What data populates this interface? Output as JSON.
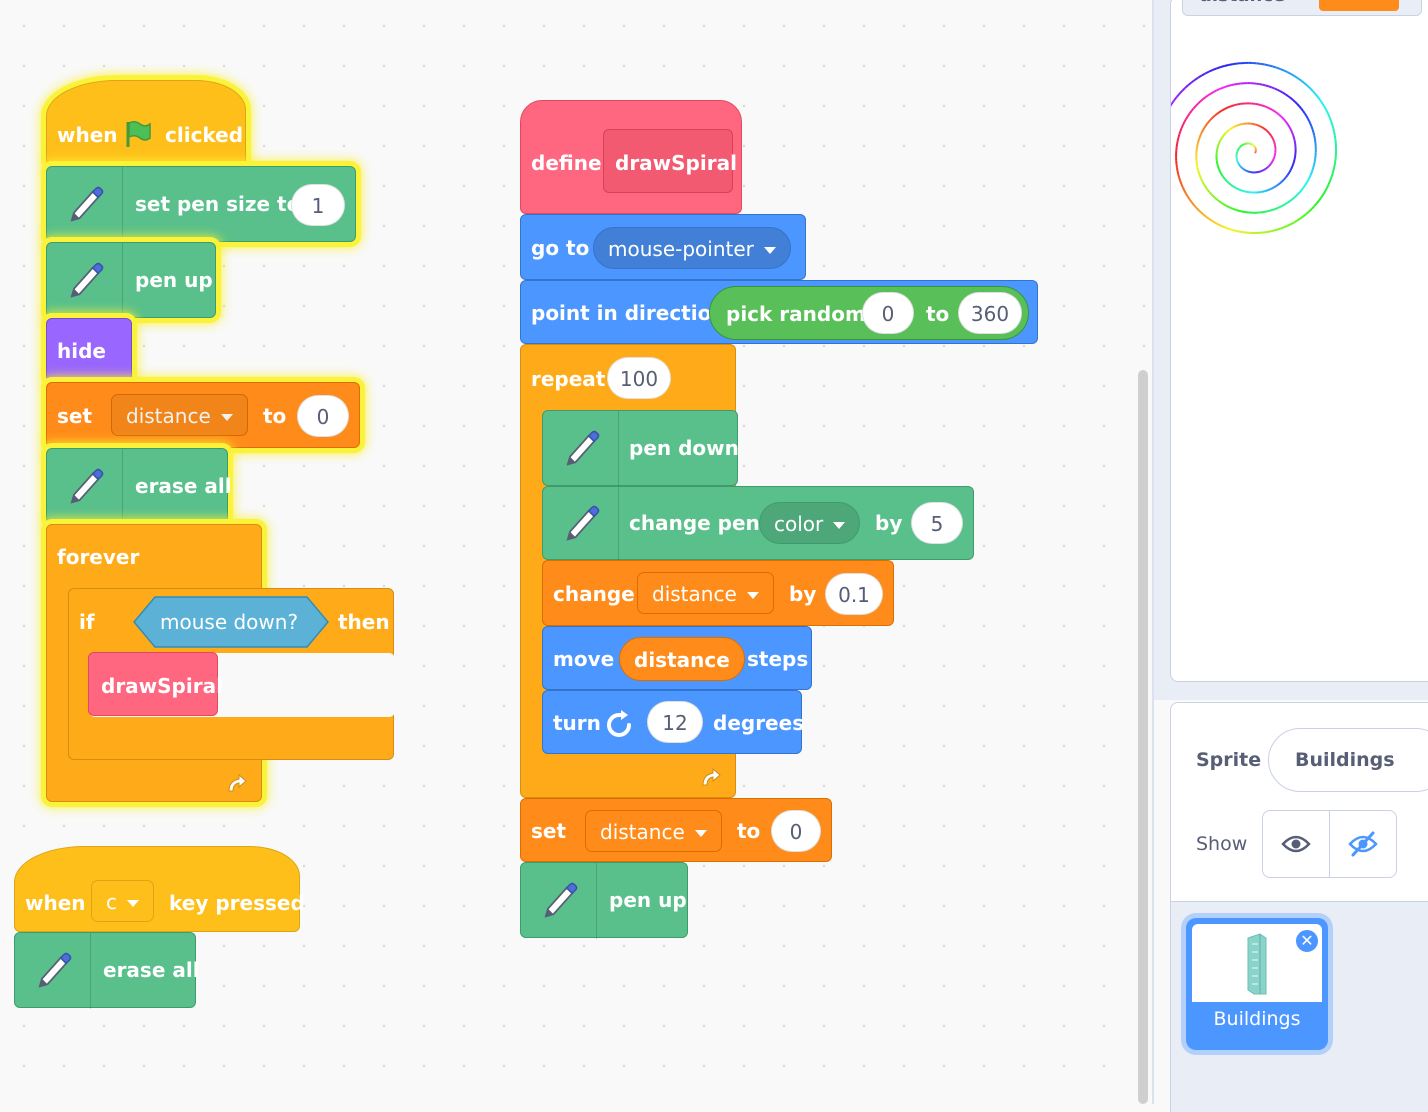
{
  "colors": {
    "pen": "#59c08c",
    "events": "#ffbf1a",
    "control": "#ffab19",
    "variables": "#ff8c1a",
    "motion": "#4c97ff",
    "looks": "#9966ff",
    "my_blocks": "#ff6680",
    "sensing": "#5cb1d6",
    "operators": "#59c059",
    "highlight": "#fbf33a"
  },
  "script1": {
    "hat": {
      "when": "when",
      "flag_icon": "green-flag-icon",
      "clicked": "clicked"
    },
    "set_pen_size": {
      "label": "set pen size to",
      "value": "1",
      "icon": "pen-icon"
    },
    "pen_up": {
      "label": "pen up",
      "icon": "pen-icon"
    },
    "hide": {
      "label": "hide"
    },
    "set_var": {
      "set": "set",
      "variable": "distance",
      "to": "to",
      "value": "0"
    },
    "erase_all": {
      "label": "erase all",
      "icon": "pen-icon"
    },
    "forever": {
      "label": "forever",
      "loop_icon": "loop-arrow-icon"
    },
    "if_block": {
      "if": "if",
      "condition": "mouse down?",
      "then": "then"
    },
    "call": {
      "label": "drawSpiral"
    }
  },
  "script2": {
    "hat": {
      "when": "when",
      "key": "c",
      "key_pressed": "key pressed"
    },
    "erase_all": {
      "label": "erase all",
      "icon": "pen-icon"
    }
  },
  "script3": {
    "define": {
      "label": "define",
      "name": "drawSpiral"
    },
    "go_to": {
      "label": "go to",
      "target": "mouse-pointer"
    },
    "point": {
      "label": "point in direction",
      "random": "pick random",
      "from": "0",
      "to": "to",
      "upto": "360"
    },
    "repeat": {
      "label": "repeat",
      "count": "100",
      "loop_icon": "loop-arrow-icon"
    },
    "pen_down": {
      "label": "pen down",
      "icon": "pen-icon"
    },
    "change_pen": {
      "label": "change pen",
      "param": "color",
      "by": "by",
      "value": "5",
      "icon": "pen-icon"
    },
    "change_var": {
      "label": "change",
      "variable": "distance",
      "by": "by",
      "value": "0.1"
    },
    "move": {
      "label": "move",
      "reporter": "distance",
      "steps": "steps"
    },
    "turn": {
      "label": "turn",
      "icon": "turn-right-icon",
      "value": "12",
      "degrees": "degrees"
    },
    "set_var": {
      "set": "set",
      "variable": "distance",
      "to": "to",
      "value": "0"
    },
    "pen_up": {
      "label": "pen up",
      "icon": "pen-icon"
    }
  },
  "stage": {
    "monitor_label": "distance"
  },
  "sprite_info": {
    "sprite_label": "Sprite",
    "sprite_name": "Buildings",
    "show_label": "Show",
    "show_icon": "eye-icon",
    "hide_icon": "eye-slash-icon"
  },
  "sprite_list": {
    "items": [
      {
        "name": "Buildings",
        "thumbnail": "building-icon",
        "delete_icon": "close-icon"
      }
    ]
  }
}
